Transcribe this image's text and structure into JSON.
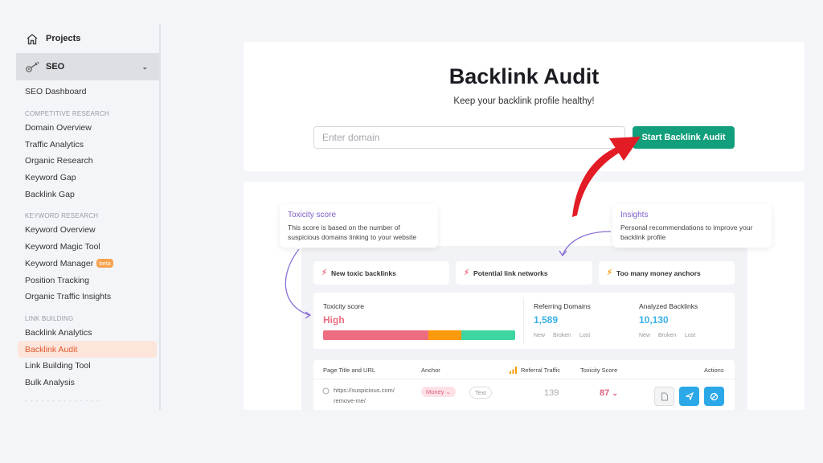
{
  "sidebar": {
    "projects_label": "Projects",
    "seo_label": "SEO",
    "seo_dashboard": "SEO Dashboard",
    "sections": [
      {
        "title": "COMPETITIVE RESEARCH",
        "items": [
          "Domain Overview",
          "Traffic Analytics",
          "Organic Research",
          "Keyword Gap",
          "Backlink Gap"
        ]
      },
      {
        "title": "KEYWORD RESEARCH",
        "items": [
          "Keyword Overview",
          "Keyword Magic Tool",
          "Keyword Manager",
          "Position Tracking",
          "Organic Traffic Insights"
        ]
      },
      {
        "title": "LINK BUILDING",
        "items": [
          "Backlink Analytics",
          "Backlink Audit",
          "Link Building Tool",
          "Bulk Analysis"
        ]
      }
    ],
    "beta_badge": "beta",
    "active_item": "Backlink Audit"
  },
  "hero": {
    "title": "Backlink Audit",
    "subtitle": "Keep your backlink profile healthy!",
    "domain_placeholder": "Enter domain",
    "domain_value": "",
    "start_button": "Start Backlink Audit"
  },
  "preview": {
    "tooltips": {
      "toxicity": {
        "title": "Toxicity score",
        "desc": "This score is based on the number of suspicious domains linking to your website"
      },
      "insights": {
        "title": "Insights",
        "desc": "Personal recommendations to improve your backlink profile"
      }
    },
    "chips": [
      "New toxic backlinks",
      "Potential link networks",
      "Too many money anchors"
    ],
    "stats": {
      "toxicity_label": "Toxicity score",
      "toxicity_value": "High",
      "toxicity_bar": {
        "high": 0.55,
        "medium": 0.17,
        "low": 0.28
      },
      "referring_label": "Referring Domains",
      "referring_value": "1,589",
      "analyzed_label": "Analyzed Backlinks",
      "analyzed_value": "10,130",
      "sub_labels": [
        "New",
        "Broken",
        "Lost"
      ]
    },
    "table": {
      "headers": [
        "Page Title and URL",
        "Anchor",
        "Referral Traffic",
        "Toxicity Score",
        "Actions"
      ],
      "row": {
        "url_line1": "https://suspicious.com/",
        "url_line2": "remove-me/",
        "anchor_tag": "Money",
        "anchor_type": "Text",
        "traffic": "139",
        "toxicity": "87"
      }
    }
  },
  "colors": {
    "accent_green": "#129f7b",
    "active_orange": "#e0582c",
    "toxic_red": "#ed6d80",
    "medium_orange": "#fb9a0a",
    "low_green": "#3dd6a0",
    "link_blue": "#3ab0e8",
    "tip_purple": "#7b5fc9",
    "arrow_red": "#e21b24"
  }
}
